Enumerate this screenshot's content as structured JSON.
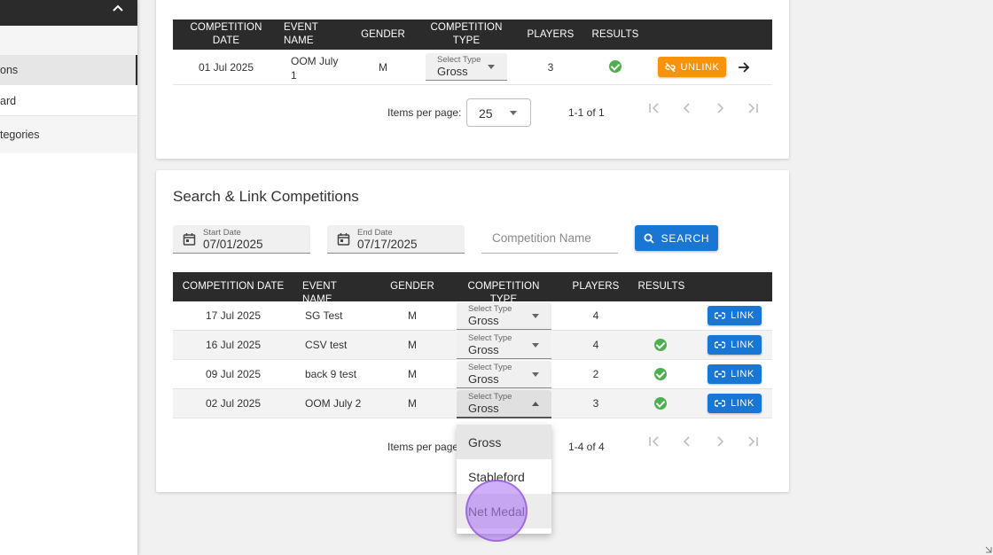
{
  "sidebar": {
    "items": [
      {
        "label": "ons"
      },
      {
        "label": "ard"
      },
      {
        "label": "tegories"
      }
    ]
  },
  "linked_table": {
    "headers": {
      "date": "COMPETITION DATE",
      "event": "EVENT NAME",
      "gender": "GENDER",
      "type": "COMPETITION TYPE",
      "players": "PLAYERS",
      "results": "RESULTS"
    },
    "rows": [
      {
        "date": "01 Jul 2025",
        "event": "OOM July 1",
        "gender": "M",
        "type_label": "Select Type",
        "type_value": "Gross",
        "players": "3",
        "action": "UNLINK"
      }
    ],
    "pager": {
      "items_per_page_label": "Items per page:",
      "items_per_page": "25",
      "range": "1-1 of 1"
    }
  },
  "search_card": {
    "title": "Search & Link Competitions",
    "start_date": {
      "label": "Start Date",
      "value": "07/01/2025"
    },
    "end_date": {
      "label": "End Date",
      "value": "07/17/2025"
    },
    "competition_name_placeholder": "Competition Name",
    "search_label": "SEARCH",
    "headers": {
      "date": "COMPETITION DATE",
      "event": "EVENT NAME",
      "gender": "GENDER",
      "type": "COMPETITION TYPE",
      "players": "PLAYERS",
      "results": "RESULTS"
    },
    "rows": [
      {
        "date": "17 Jul 2025",
        "event": "SG Test",
        "gender": "M",
        "type_label": "Select Type",
        "type_value": "Gross",
        "players": "4",
        "action": "LINK"
      },
      {
        "date": "16 Jul 2025",
        "event": "CSV test",
        "gender": "M",
        "type_label": "Select Type",
        "type_value": "Gross",
        "players": "4",
        "action": "LINK"
      },
      {
        "date": "09 Jul 2025",
        "event": "back 9 test",
        "gender": "M",
        "type_label": "Select Type",
        "type_value": "Gross",
        "players": "2",
        "action": "LINK"
      },
      {
        "date": "02 Jul 2025",
        "event": "OOM July 2",
        "gender": "M",
        "type_label": "Select Type",
        "type_value": "Gross",
        "players": "3",
        "action": "LINK"
      }
    ],
    "pager": {
      "items_per_page_label": "Items per page",
      "range": "1-4 of 4"
    }
  },
  "dropdown": {
    "options": [
      "Gross",
      "Stableford",
      "Net Medal"
    ]
  },
  "colors": {
    "primary": "#1976d2",
    "warning": "#f7930a",
    "success": "#4caf50",
    "header": "#2b2b2b"
  }
}
